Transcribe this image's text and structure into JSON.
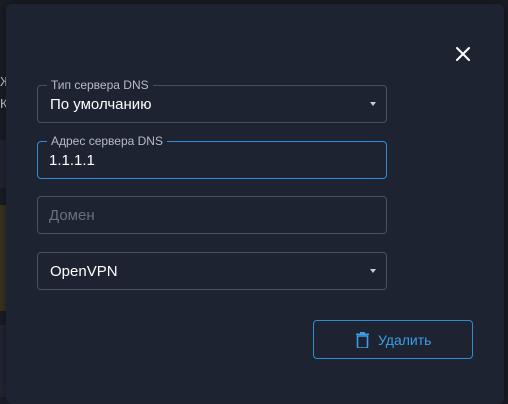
{
  "colors": {
    "dialog_bg": "#1d2331",
    "accent": "#2d8ed4",
    "field_border": "#4a5061",
    "text": "#ffffff",
    "label": "#b7bbc6"
  },
  "background": {
    "fragment_1": "Ж",
    "fragment_2": "К"
  },
  "dialog": {
    "close_icon": "close-icon",
    "dns_server_type": {
      "label": "Тип сервера DNS",
      "value": "По умолчанию"
    },
    "dns_server_address": {
      "label": "Адрес сервера DNS",
      "value": "1.1.1.1"
    },
    "domain": {
      "placeholder": "Домен",
      "value": ""
    },
    "protocol": {
      "value": "OpenVPN"
    },
    "delete_button": {
      "label": "Удалить",
      "icon": "trash-icon"
    }
  }
}
